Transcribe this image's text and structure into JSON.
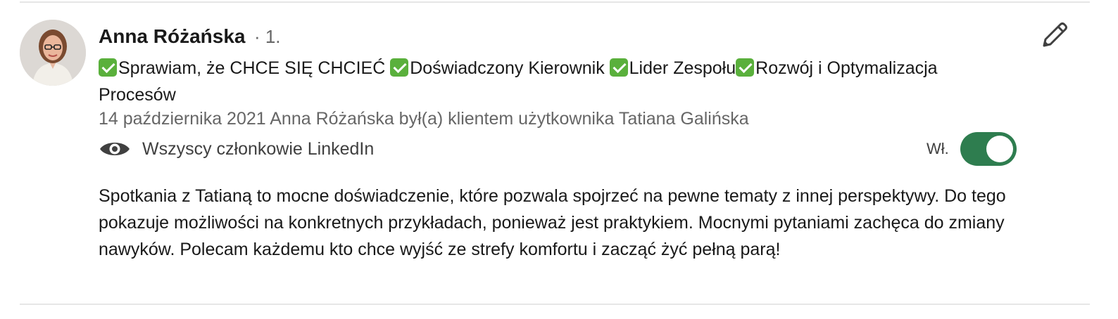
{
  "author": {
    "name": "Anna Różańska",
    "degree": "· 1.",
    "headline_parts": [
      "Sprawiam, że CHCE SIĘ CHCIEĆ ",
      "Doświadczony Kierownik ",
      "Lider Zespołu",
      "Rozwój i Optymalizacja Procesów"
    ]
  },
  "recommendation": {
    "meta": "14 października 2021 Anna Różańska był(a) klientem użytkownika Tatiana Galińska",
    "text": "Spotkania z Tatianą to mocne doświadczenie, które pozwala spojrzeć na pewne tematy z innej perspektywy. Do tego pokazuje możliwości na konkretnych przykładach, ponieważ jest praktykiem. Mocnymi pytaniami zachęca do zmiany nawyków. Polecam każdemu kto chce wyjść ze strefy komfortu i zacząć żyć pełną parą!"
  },
  "visibility": {
    "label": "Wszyscy członkowie LinkedIn",
    "icon": "eye-icon"
  },
  "toggle": {
    "label": "Wł.",
    "on": true,
    "color": "#2e7d4f"
  },
  "edit": {
    "icon": "pencil-icon"
  },
  "colors": {
    "check": "#5ab03c",
    "text": "#191919",
    "muted": "#666666"
  }
}
